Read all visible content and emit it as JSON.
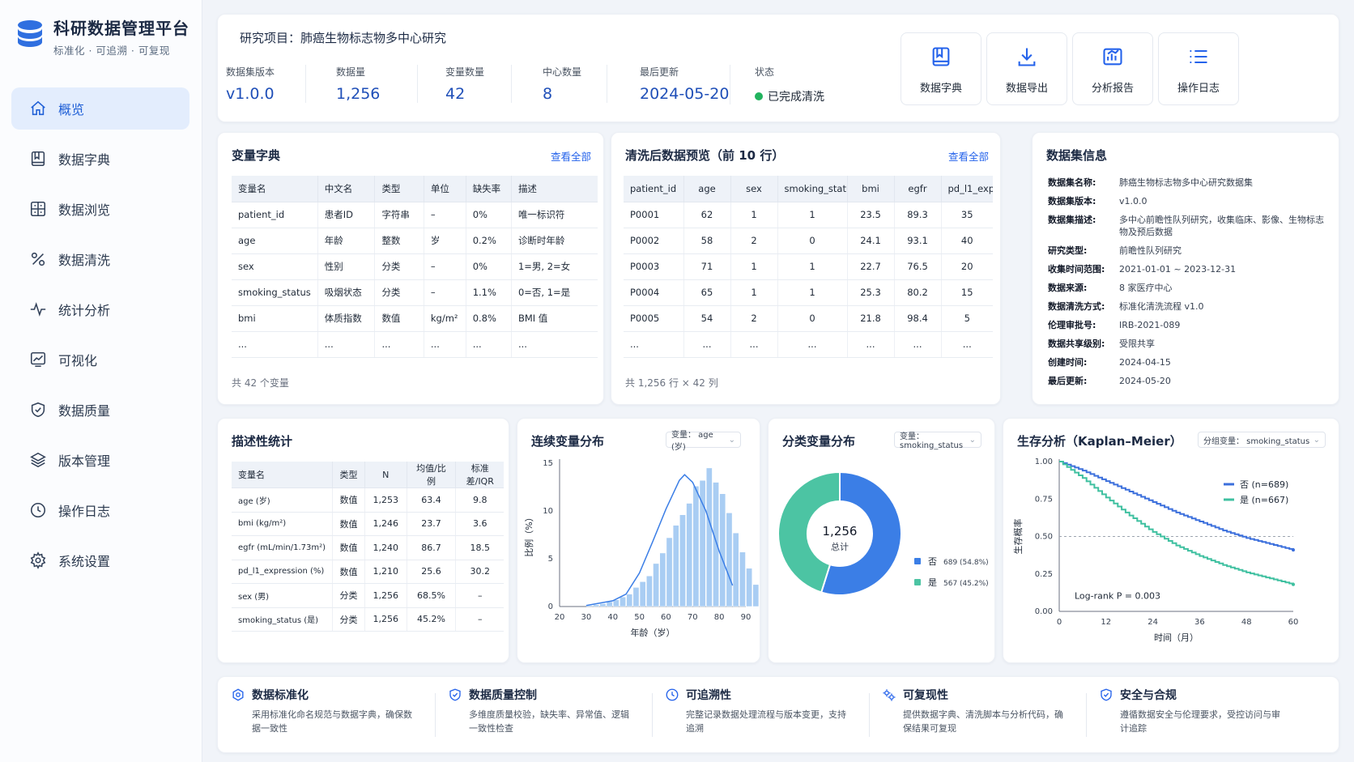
{
  "app": {
    "title": "科研数据管理平台",
    "subtitle": "标准化 · 可追溯 · 可复现"
  },
  "nav": [
    {
      "label": "概览",
      "icon": "home-icon",
      "active": true
    },
    {
      "label": "数据字典",
      "icon": "book-icon"
    },
    {
      "label": "数据浏览",
      "icon": "grid-icon"
    },
    {
      "label": "数据清洗",
      "icon": "percent-icon"
    },
    {
      "label": "统计分析",
      "icon": "pulse-icon"
    },
    {
      "label": "可视化",
      "icon": "chart-icon"
    },
    {
      "label": "数据质量",
      "icon": "shield-icon"
    },
    {
      "label": "版本管理",
      "icon": "layers-icon"
    },
    {
      "label": "操作日志",
      "icon": "clock-icon"
    },
    {
      "label": "系统设置",
      "icon": "gear-icon"
    }
  ],
  "header": {
    "project": "研究项目：肺癌生物标志物多中心研究",
    "metrics": [
      {
        "label": "数据集版本",
        "value": "v1.0.0"
      },
      {
        "label": "数据量",
        "value": "1,256"
      },
      {
        "label": "变量数量",
        "value": "42"
      },
      {
        "label": "中心数量",
        "value": "8"
      },
      {
        "label": "最后更新",
        "value": "2024-05-20"
      },
      {
        "label": "状态",
        "value": "已完成清洗"
      }
    ],
    "actions": [
      {
        "label": "数据字典",
        "icon": "book-icon"
      },
      {
        "label": "数据导出",
        "icon": "download-icon"
      },
      {
        "label": "分析报告",
        "icon": "report-chart-icon"
      },
      {
        "label": "操作日志",
        "icon": "list-icon"
      }
    ]
  },
  "dictionary": {
    "title": "变量字典",
    "link": "查看全部",
    "columns": [
      "变量名",
      "中文名",
      "类型",
      "单位",
      "缺失率",
      "描述"
    ],
    "rows": [
      [
        "patient_id",
        "患者ID",
        "字符串",
        "–",
        "0%",
        "唯一标识符"
      ],
      [
        "age",
        "年龄",
        "整数",
        "岁",
        "0.2%",
        "诊断时年龄"
      ],
      [
        "sex",
        "性别",
        "分类",
        "–",
        "0%",
        "1=男, 2=女"
      ],
      [
        "smoking_status",
        "吸烟状态",
        "分类",
        "–",
        "1.1%",
        "0=否, 1=是"
      ],
      [
        "bmi",
        "体质指数",
        "数值",
        "kg/m²",
        "0.8%",
        "BMI 值"
      ],
      [
        "...",
        "...",
        "...",
        "...",
        "...",
        "..."
      ]
    ],
    "footer": "共 42 个变量"
  },
  "preview": {
    "title": "清洗后数据预览（前 10 行）",
    "link": "查看全部",
    "columns": [
      "patient_id",
      "age",
      "sex",
      "smoking_status",
      "bmi",
      "egfr",
      "pd_l1_exp.."
    ],
    "rows": [
      [
        "P0001",
        "62",
        "1",
        "1",
        "23.5",
        "89.3",
        "35"
      ],
      [
        "P0002",
        "58",
        "2",
        "0",
        "24.1",
        "93.1",
        "40"
      ],
      [
        "P0003",
        "71",
        "1",
        "1",
        "22.7",
        "76.5",
        "20"
      ],
      [
        "P0004",
        "65",
        "1",
        "1",
        "25.3",
        "80.2",
        "15"
      ],
      [
        "P0005",
        "54",
        "2",
        "0",
        "21.8",
        "98.4",
        "5"
      ],
      [
        "...",
        "...",
        "...",
        "...",
        "...",
        "...",
        "..."
      ]
    ],
    "footer": "共 1,256 行 × 42 列"
  },
  "dataset_info": {
    "title": "数据集信息",
    "rows": [
      {
        "k": "数据集名称:",
        "v": "肺癌生物标志物多中心研究数据集"
      },
      {
        "k": "数据集版本:",
        "v": "v1.0.0"
      },
      {
        "k": "数据集描述:",
        "v": "多中心前瞻性队列研究，收集临床、影像、生物标志物及预后数据"
      },
      {
        "k": "研究类型:",
        "v": "前瞻性队列研究"
      },
      {
        "k": "收集时间范围:",
        "v": "2021-01-01 ~ 2023-12-31"
      },
      {
        "k": "数据来源:",
        "v": "8 家医疗中心"
      },
      {
        "k": "数据清洗方式:",
        "v": "标准化清洗流程 v1.0"
      },
      {
        "k": "伦理审批号:",
        "v": "IRB-2021-089"
      },
      {
        "k": "数据共享级别:",
        "v": "受限共享"
      },
      {
        "k": "创建时间:",
        "v": "2024-04-15"
      },
      {
        "k": "最后更新:",
        "v": "2024-05-20"
      }
    ]
  },
  "desc_stats": {
    "title": "描述性统计",
    "columns": [
      "变量名",
      "类型",
      "N",
      "均值/比例",
      "标准差/IQR"
    ],
    "rows": [
      [
        "age (岁)",
        "数值",
        "1,253",
        "63.4",
        "9.8"
      ],
      [
        "bmi (kg/m²)",
        "数值",
        "1,246",
        "23.7",
        "3.6"
      ],
      [
        "egfr (mL/min/1.73m²)",
        "数值",
        "1,240",
        "86.7",
        "18.5"
      ],
      [
        "pd_l1_expression (%)",
        "数值",
        "1,210",
        "25.6",
        "30.2"
      ],
      [
        "sex (男)",
        "分类",
        "1,256",
        "68.5%",
        "–"
      ],
      [
        "smoking_status (是)",
        "分类",
        "1,256",
        "45.2%",
        "–"
      ]
    ]
  },
  "hist_card": {
    "title": "连续变量分布",
    "select": "变量：  age (岁)"
  },
  "pie_card": {
    "title": "分类变量分布",
    "select": "变量：  smoking_status"
  },
  "km_card": {
    "title": "生存分析（Kaplan–Meier）",
    "select": "分组变量：  smoking_status"
  },
  "chart_data": [
    {
      "type": "bar",
      "xlabel": "年龄（岁）",
      "ylabel": "比例（%）",
      "xlim": [
        20,
        90
      ],
      "ylim": [
        0,
        15
      ],
      "xticks": [
        20,
        30,
        40,
        50,
        60,
        70,
        80,
        90
      ],
      "yticks": [
        0,
        5,
        10,
        15
      ],
      "bin_width": 2.5,
      "bins_start": 30,
      "values": [
        0.1,
        0.2,
        0.3,
        0.5,
        0.7,
        1.0,
        1.3,
        2.0,
        2.6,
        3.2,
        4.5,
        5.6,
        7.2,
        8.5,
        9.6,
        10.8,
        12.6,
        13.2,
        14.5,
        13.0,
        11.8,
        9.8,
        7.7,
        5.7,
        4.0,
        2.3
      ],
      "curve": [
        [
          30,
          0.1
        ],
        [
          40,
          0.6
        ],
        [
          45,
          1.3
        ],
        [
          50,
          3.5
        ],
        [
          55,
          6.8
        ],
        [
          60,
          10.2
        ],
        [
          65,
          13.2
        ],
        [
          67,
          13.8
        ],
        [
          70,
          13.0
        ],
        [
          75,
          10.0
        ],
        [
          80,
          5.8
        ],
        [
          85,
          2.2
        ]
      ]
    },
    {
      "type": "pie",
      "labels": [
        "否",
        "是"
      ],
      "values": [
        689,
        567
      ],
      "percent_labels": [
        "689 (54.8%)",
        "567 (45.2%)"
      ],
      "colors": [
        "#3b7ee6",
        "#4cc4a3"
      ],
      "center_value": "1,256",
      "center_label": "总计"
    },
    {
      "type": "line",
      "ylabel": "生存概率",
      "xlabel": "时间（月）",
      "xlim": [
        0,
        60
      ],
      "ylim": [
        0,
        1
      ],
      "xticks": [
        0,
        12,
        24,
        36,
        48,
        60
      ],
      "yticks": [
        "0.00",
        "0.25",
        "0.50",
        "0.75",
        "1.00"
      ],
      "series": [
        {
          "name": "否  (n=689)",
          "color": "#3b6fdc",
          "x": [
            0,
            6,
            12,
            18,
            24,
            30,
            36,
            42,
            48,
            54,
            60
          ],
          "y": [
            1.0,
            0.94,
            0.87,
            0.8,
            0.73,
            0.66,
            0.6,
            0.54,
            0.49,
            0.45,
            0.41
          ]
        },
        {
          "name": "是  (n=667)",
          "color": "#3fc0a0",
          "x": [
            0,
            6,
            12,
            18,
            24,
            30,
            36,
            42,
            48,
            54,
            60
          ],
          "y": [
            1.0,
            0.89,
            0.76,
            0.64,
            0.53,
            0.44,
            0.37,
            0.31,
            0.26,
            0.22,
            0.18
          ]
        }
      ],
      "reference_line": 0.5,
      "annotation": "Log-rank P = 0.003"
    }
  ],
  "features": [
    {
      "title": "数据标准化",
      "desc": "采用标准化命名规范与数据字典，确保数据一致性",
      "icon": "settings-icon"
    },
    {
      "title": "数据质量控制",
      "desc": "多维度质量校验，缺失率、异常值、逻辑一致性检查",
      "icon": "shield-check-icon"
    },
    {
      "title": "可追溯性",
      "desc": "完整记录数据处理流程与版本变更，支持追溯",
      "icon": "clock-icon"
    },
    {
      "title": "可复现性",
      "desc": "提供数据字典、清洗脚本与分析代码，确保结果可复现",
      "icon": "gears-icon"
    },
    {
      "title": "安全与合规",
      "desc": "遵循数据安全与伦理要求，受控访问与审计追踪",
      "icon": "shield-icon"
    }
  ]
}
